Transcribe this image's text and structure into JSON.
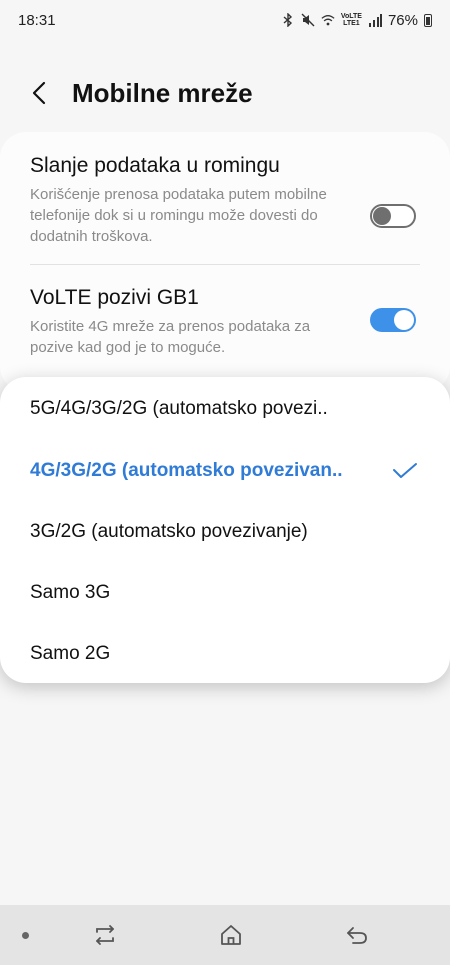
{
  "status_bar": {
    "time": "18:31",
    "volte_top": "VoLTE",
    "volte_bottom": "LTE1",
    "battery": "76%"
  },
  "header": {
    "title": "Mobilne mreže",
    "back_icon": "back-arrow-icon"
  },
  "settings": {
    "roaming": {
      "title": "Slanje podataka u romingu",
      "description": "Korišćenje prenosa podataka putem mobilne telefonije dok si u romingu može dovesti do dodatnih troškova.",
      "enabled": false
    },
    "volte": {
      "title": "VoLTE pozivi GB1",
      "description": "Koristite 4G mreže za prenos podataka za pozive kad god je to moguće.",
      "enabled": true
    }
  },
  "network_mode_menu": {
    "options": [
      {
        "label": "5G/4G/3G/2G (automatsko povezi..",
        "selected": false
      },
      {
        "label": "4G/3G/2G (automatsko povezivan..",
        "selected": true
      },
      {
        "label": "3G/2G (automatsko povezivanje)",
        "selected": false
      },
      {
        "label": "Samo 3G",
        "selected": false
      },
      {
        "label": "Samo 2G",
        "selected": false
      }
    ]
  },
  "colors": {
    "accent": "#3e91e8",
    "selected_text": "#2f7bd6",
    "background": "#f6f6f6",
    "nav_bar": "#e4e4e4"
  },
  "nav_bar": {
    "icons": [
      "recent-apps-icon",
      "home-icon",
      "back-icon"
    ]
  }
}
